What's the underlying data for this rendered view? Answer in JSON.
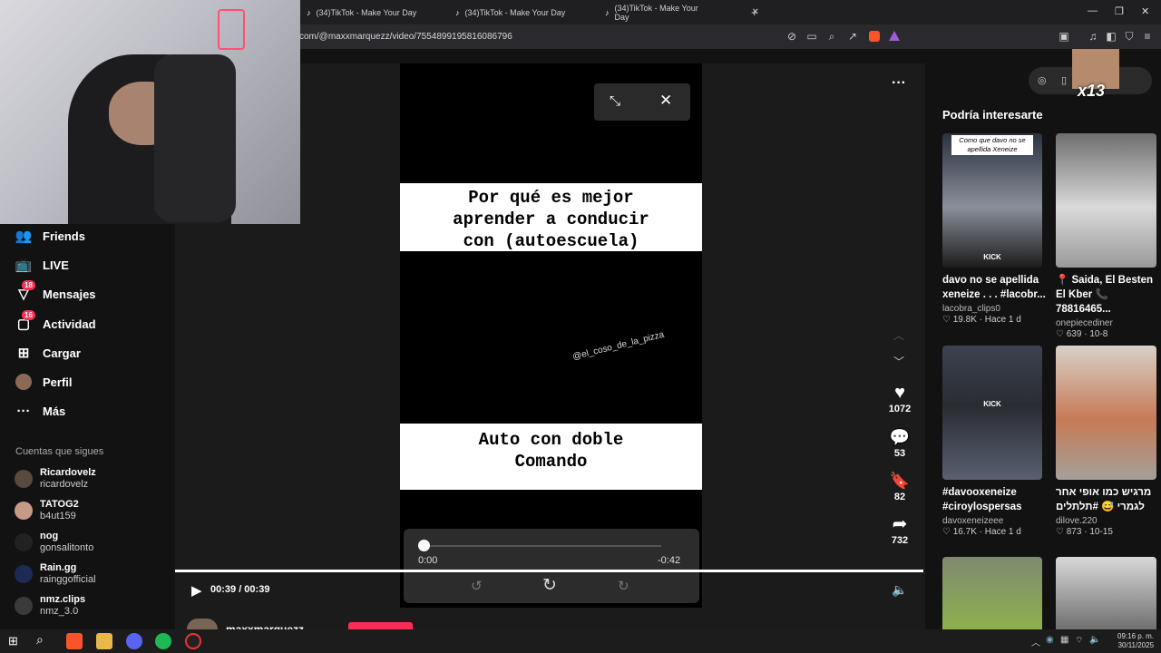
{
  "browser": {
    "tabs": [
      {
        "title": "(34)TikTok - Make Your Day"
      },
      {
        "title": "(34)TikTok - Make Your Day"
      },
      {
        "title": "(34)TikTok - Make Your Day"
      }
    ],
    "url": "com/@maxxmarquezz/video/7554899195816086796"
  },
  "sidebar": {
    "items": [
      {
        "label": "Friends",
        "icon": "friends-icon"
      },
      {
        "label": "LIVE",
        "icon": "live-icon"
      },
      {
        "label": "Mensajes",
        "icon": "messages-icon",
        "badge": "18"
      },
      {
        "label": "Actividad",
        "icon": "activity-icon",
        "badge": "16"
      },
      {
        "label": "Cargar",
        "icon": "upload-icon"
      },
      {
        "label": "Perfil",
        "icon": "profile-icon"
      },
      {
        "label": "Más",
        "icon": "more-icon"
      }
    ],
    "following_title": "Cuentas que sigues",
    "following": [
      {
        "name": "Ricardovelz",
        "handle": "ricardovelz"
      },
      {
        "name": "TATOG2",
        "handle": "b4ut159"
      },
      {
        "name": "nog",
        "handle": "gonsalitonto"
      },
      {
        "name": "Rain.gg",
        "handle": "rainggofficial"
      },
      {
        "name": "nmz.clips",
        "handle": "nmz_3.0"
      }
    ]
  },
  "video": {
    "caption_top": [
      "Por qué es mejor",
      "aprender a conducir",
      "con (autoescuela)"
    ],
    "caption_bottom": [
      "Auto con doble",
      "Comando"
    ],
    "watermark": "@el_coso_de_la_pizza",
    "inner_time_start": "0:00",
    "inner_time_remaining": "-0:42",
    "time": "00:39 / 00:39",
    "progress": 1.0,
    "author_partial": "maxxmarquezz"
  },
  "actions": {
    "likes": "1072",
    "comments": "53",
    "saves": "82",
    "shares": "732"
  },
  "recommendations": {
    "title": "Podría interesarte",
    "cards": [
      {
        "title": "davo no se apellida xeneize . . . #lacobr...",
        "author": "lacobra_clips0",
        "likes": "19.8K",
        "age": "Hace 1 d",
        "thumb_text": "Como que davo no se apellida Xeneize",
        "thumb_label": "KICK"
      },
      {
        "title": "📍 Saida, El Besten El Kber 📞 78816465...",
        "author": "onepiecediner",
        "likes": "639",
        "age": "10-8",
        "thumb_text": "",
        "thumb_label": ""
      },
      {
        "title": "#davooxeneize #ciroylospersas",
        "author": "davoxeneizeee",
        "likes": "16.7K",
        "age": "Hace 1 d",
        "thumb_text": "",
        "thumb_label": "KICK"
      },
      {
        "title": "מרגיש כמו אופי אחר לגמרי 😅 #תלתלים",
        "author": "dilove.220",
        "likes": "873",
        "age": "10-15",
        "thumb_text": "",
        "thumb_label": ""
      }
    ]
  },
  "overlay": {
    "counter": "x13"
  },
  "taskbar": {
    "time": "09:16 p. m.",
    "date": "30/11/2025"
  }
}
